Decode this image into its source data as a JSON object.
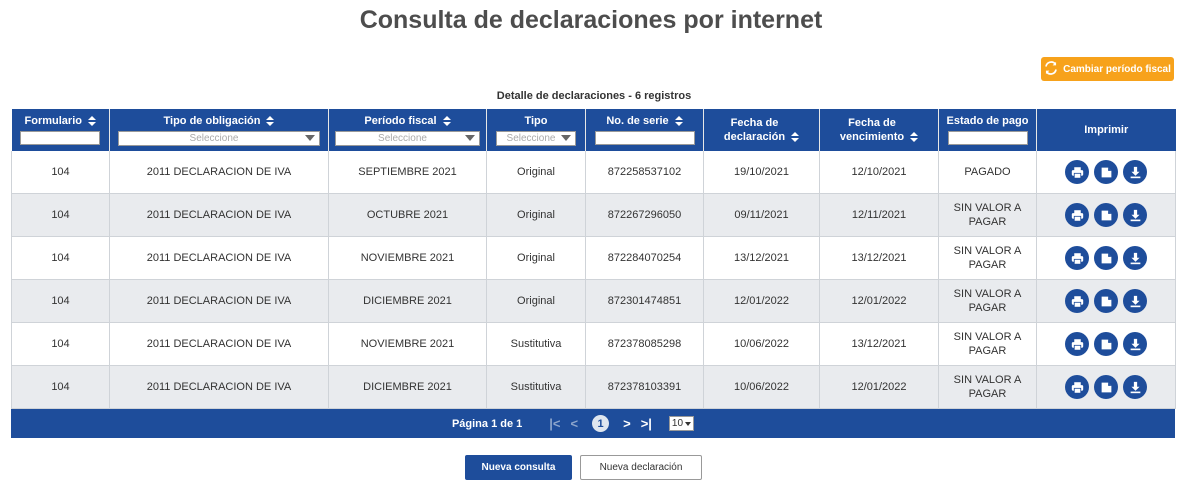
{
  "page": {
    "title": "Consulta de declaraciones por internet"
  },
  "toolbar": {
    "change_period_label": "Cambiar período fiscal"
  },
  "table": {
    "caption": "Detalle de declaraciones - 6 registros",
    "headers": {
      "formulario": "Formulario",
      "tipo_obligacion": "Tipo de obligación",
      "periodo": "Período fiscal",
      "tipo": "Tipo",
      "serie": "No. de serie",
      "fecha_decl_1": "Fecha de",
      "fecha_decl_2": "declaración",
      "fecha_venc_1": "Fecha de",
      "fecha_venc_2": "vencimiento",
      "estado": "Estado de pago",
      "imprimir": "Imprimir"
    },
    "select_placeholder": "Seleccione",
    "rows": [
      {
        "formulario": "104",
        "obligacion": "2011 DECLARACION DE IVA",
        "periodo": "SEPTIEMBRE 2021",
        "tipo": "Original",
        "serie": "872258537102",
        "fecha_decl": "19/10/2021",
        "fecha_venc": "12/10/2021",
        "estado_1": "PAGADO",
        "estado_2": ""
      },
      {
        "formulario": "104",
        "obligacion": "2011 DECLARACION DE IVA",
        "periodo": "OCTUBRE 2021",
        "tipo": "Original",
        "serie": "872267296050",
        "fecha_decl": "09/11/2021",
        "fecha_venc": "12/11/2021",
        "estado_1": "SIN VALOR A",
        "estado_2": "PAGAR"
      },
      {
        "formulario": "104",
        "obligacion": "2011 DECLARACION DE IVA",
        "periodo": "NOVIEMBRE 2021",
        "tipo": "Original",
        "serie": "872284070254",
        "fecha_decl": "13/12/2021",
        "fecha_venc": "13/12/2021",
        "estado_1": "SIN VALOR A",
        "estado_2": "PAGAR"
      },
      {
        "formulario": "104",
        "obligacion": "2011 DECLARACION DE IVA",
        "periodo": "DICIEMBRE 2021",
        "tipo": "Original",
        "serie": "872301474851",
        "fecha_decl": "12/01/2022",
        "fecha_venc": "12/01/2022",
        "estado_1": "SIN VALOR A",
        "estado_2": "PAGAR"
      },
      {
        "formulario": "104",
        "obligacion": "2011 DECLARACION DE IVA",
        "periodo": "NOVIEMBRE 2021",
        "tipo": "Sustitutiva",
        "serie": "872378085298",
        "fecha_decl": "10/06/2022",
        "fecha_venc": "13/12/2021",
        "estado_1": "SIN VALOR A",
        "estado_2": "PAGAR"
      },
      {
        "formulario": "104",
        "obligacion": "2011 DECLARACION DE IVA",
        "periodo": "DICIEMBRE 2021",
        "tipo": "Sustitutiva",
        "serie": "872378103391",
        "fecha_decl": "10/06/2022",
        "fecha_venc": "12/01/2022",
        "estado_1": "SIN VALOR A",
        "estado_2": "PAGAR"
      }
    ]
  },
  "pagination": {
    "label": "Página 1 de 1",
    "first": "|<",
    "prev": "<",
    "current": "1",
    "next": ">",
    "last": ">|",
    "page_size": "10"
  },
  "footer": {
    "new_query_label": "Nueva consulta",
    "new_declaration_label": "Nueva declaración"
  },
  "colors": {
    "primary": "#1e4d9b",
    "accent": "#f7a21b",
    "row_alt": "#e9ebee"
  },
  "icons": {
    "refresh": "refresh-icon",
    "print": "printer-icon",
    "document": "document-icon",
    "download": "download-icon"
  }
}
